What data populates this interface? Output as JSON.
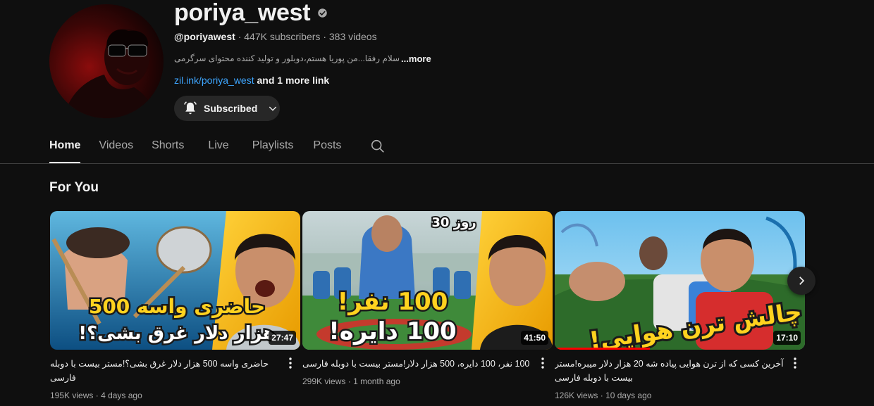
{
  "channel": {
    "name": "poriya_west",
    "verified_icon": "verified-check-icon",
    "handle": "@poriyawest",
    "subscribers": "447K subscribers",
    "videos": "383 videos",
    "separator": "·",
    "description": "سلام رفقا...من پوریا هستم،دوبلور و تولید کننده محتوای سرگرمی",
    "description_more": "...more",
    "link": "zil.ink/poriya_west",
    "more_links": "and 1 more link",
    "subscribe_label": "Subscribed"
  },
  "tabs": [
    {
      "label": "Home",
      "active": true
    },
    {
      "label": "Videos",
      "active": false
    },
    {
      "label": "Shorts",
      "active": false
    },
    {
      "label": "Live",
      "active": false
    },
    {
      "label": "Playlists",
      "active": false
    },
    {
      "label": "Posts",
      "active": false
    }
  ],
  "section": {
    "title": "For You"
  },
  "videos": [
    {
      "title": "حاضری واسه 500 هزار دلار غرق بشی؟!مستر بیست با دوبله فارسی",
      "views": "195K views",
      "age": "4 days ago",
      "duration": "27:47",
      "thumb_line1": "حاضری واسه 500",
      "thumb_line2": "هزار دلار غرق بشی؟!"
    },
    {
      "title": "100 نفر، 100 دایره، 500 هزار دلار!مستر بیست با دوبله فارسی",
      "views": "299K views",
      "age": "1 month ago",
      "duration": "41:50",
      "thumb_badge": "روز 30",
      "thumb_line1": "100 نفر!",
      "thumb_line2": "100 دایره!"
    },
    {
      "title": "آخرین کسی که از ترن هوایی پیاده شه 20 هزار دلار میبره!مستر بیست با دوبله فارسی",
      "views": "126K views",
      "age": "10 days ago",
      "duration": "17:10",
      "thumb_line1": "چالش ترن هوایی!",
      "watched_fraction": 0.38
    }
  ],
  "colors": {
    "background": "#0f0f0f",
    "link": "#3ea6ff",
    "progress": "#ff0000",
    "thumb_text": "#ffcc00"
  }
}
